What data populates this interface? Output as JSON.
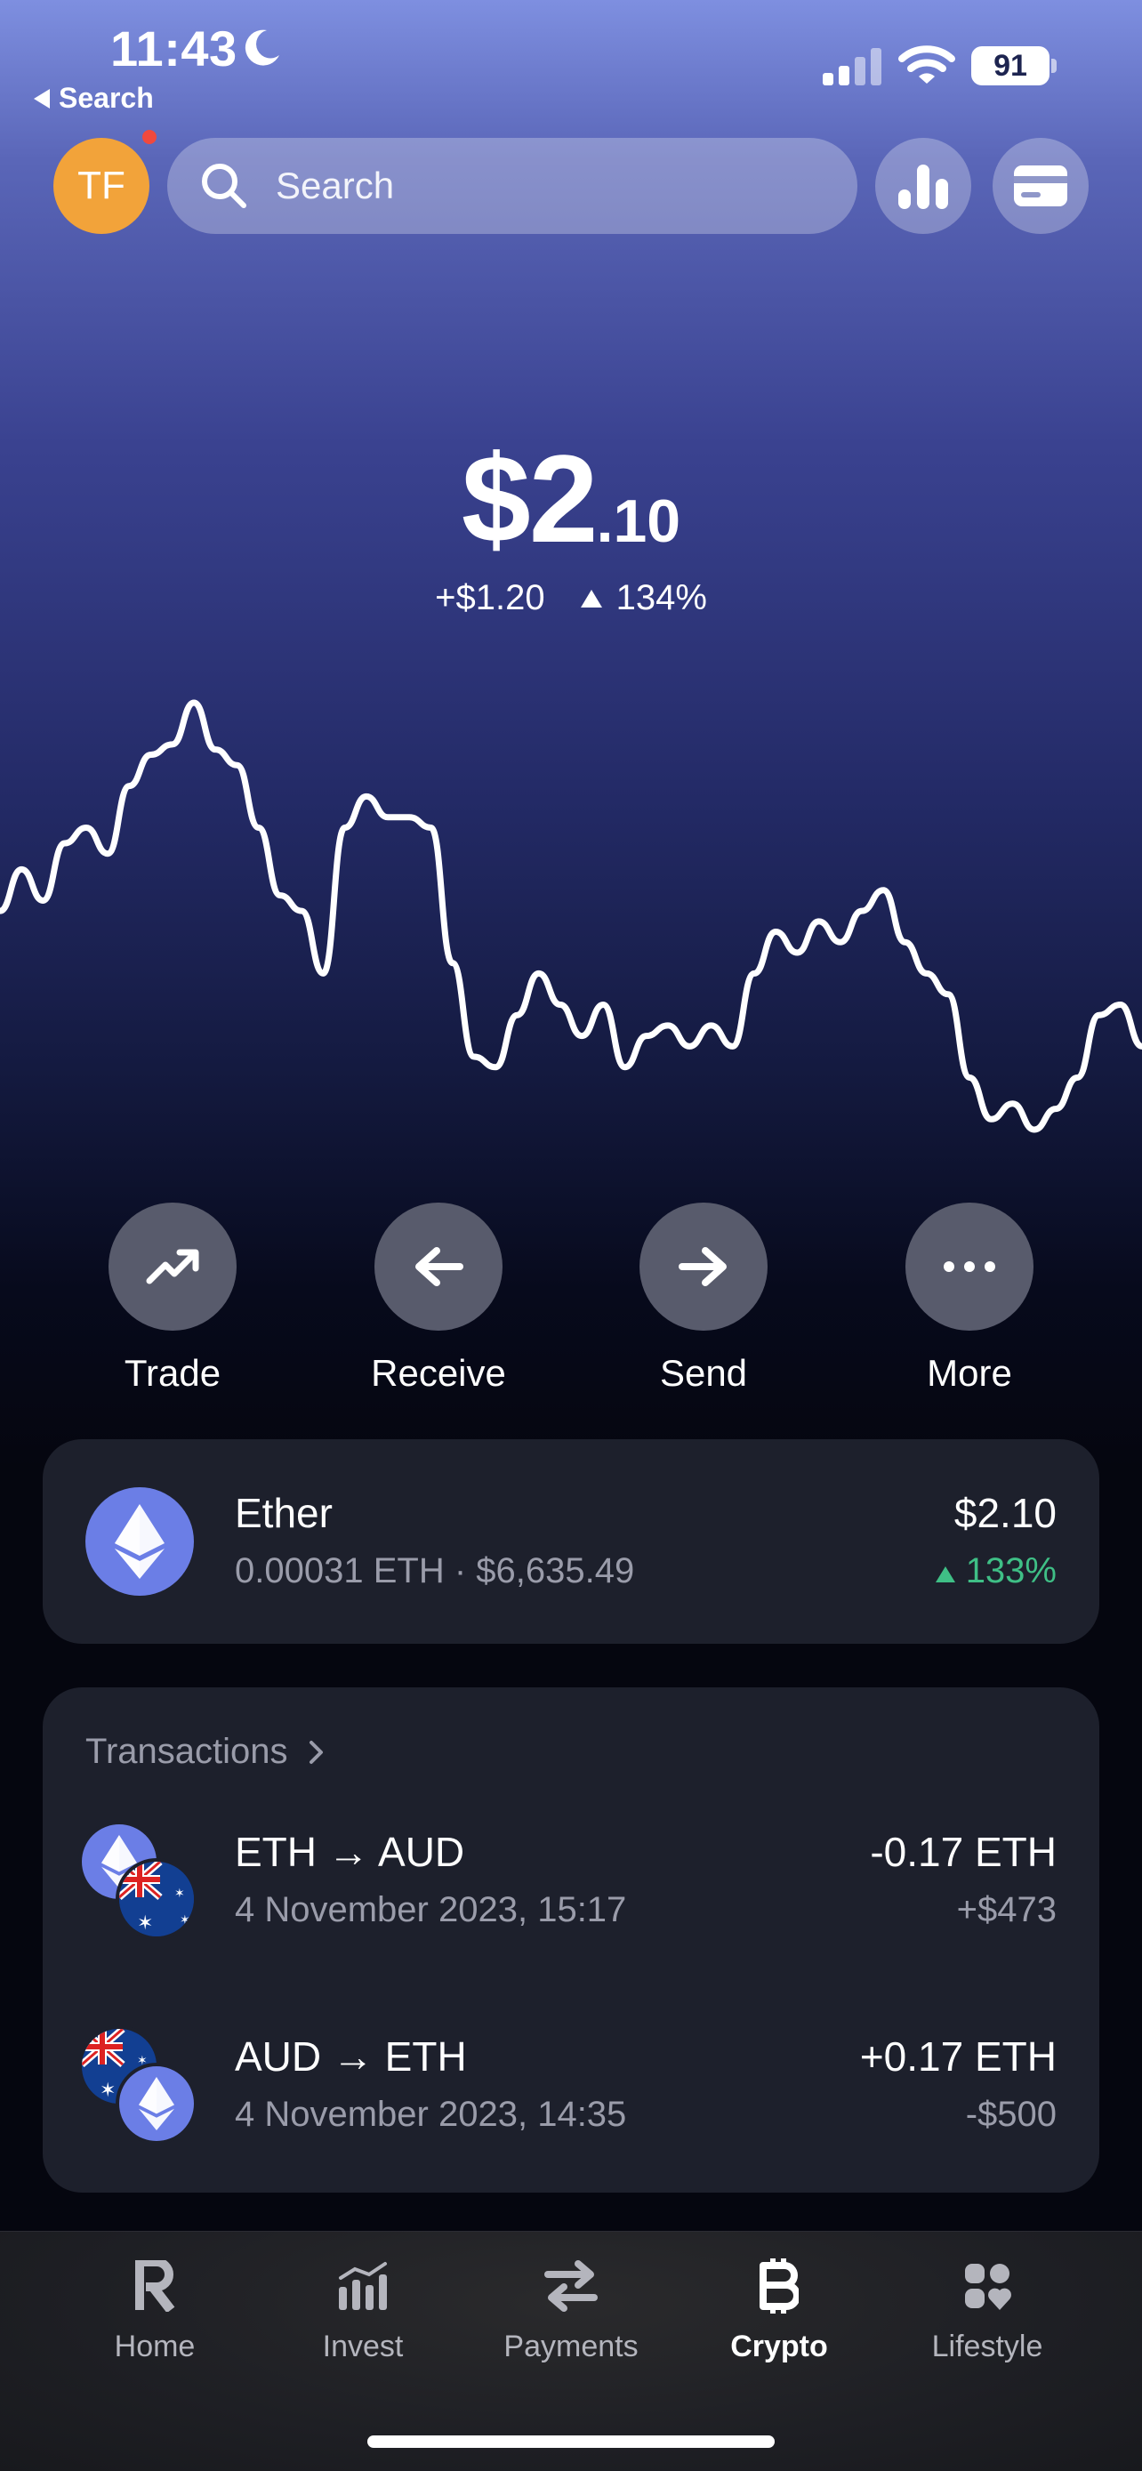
{
  "status_bar": {
    "time": "11:43",
    "back_label": "Search",
    "battery": "91"
  },
  "header": {
    "avatar_initials": "TF",
    "search_placeholder": "Search"
  },
  "balance": {
    "main": "$2",
    "cents": ".10",
    "change_amount": "+$1.20",
    "change_percent": "134%"
  },
  "price_chart": {
    "series": [
      42,
      50,
      44,
      55,
      58,
      53,
      66,
      72,
      74,
      82,
      73,
      70,
      58,
      45,
      42,
      30,
      58,
      64,
      60,
      60,
      58,
      32,
      14,
      12,
      22,
      30,
      24,
      18,
      24,
      12,
      18,
      20,
      16,
      20,
      16,
      30,
      38,
      34,
      40,
      36,
      42,
      46,
      36,
      30,
      26,
      10,
      2,
      5,
      0,
      4,
      10,
      22,
      24,
      16
    ]
  },
  "actions": [
    {
      "label": "Trade",
      "icon": "trend-up-icon"
    },
    {
      "label": "Receive",
      "icon": "arrow-left-icon"
    },
    {
      "label": "Send",
      "icon": "arrow-right-icon"
    },
    {
      "label": "More",
      "icon": "ellipsis-icon"
    }
  ],
  "asset": {
    "name": "Ether",
    "detail": "0.00031 ETH · $6,635.49",
    "value": "$2.10",
    "change": "133%"
  },
  "transactions": {
    "header": "Transactions",
    "items": [
      {
        "title": "ETH → AUD",
        "date": "4 November 2023, 15:17",
        "amount": "-0.17 ETH",
        "fiat": "+$473"
      },
      {
        "title": "AUD → ETH",
        "date": "4 November 2023, 14:35",
        "amount": "+0.17 ETH",
        "fiat": "-$500"
      }
    ]
  },
  "tabbar": [
    {
      "label": "Home",
      "icon": "revolut-logo-icon"
    },
    {
      "label": "Invest",
      "icon": "invest-chart-icon"
    },
    {
      "label": "Payments",
      "icon": "transfer-arrows-icon"
    },
    {
      "label": "Crypto",
      "icon": "bitcoin-icon",
      "active": true
    },
    {
      "label": "Lifestyle",
      "icon": "lifestyle-grid-icon"
    }
  ],
  "colors": {
    "accent_green": "#3fbf86",
    "avatar_orange": "#f2a33a",
    "ether_purple": "#6b7ee6"
  }
}
